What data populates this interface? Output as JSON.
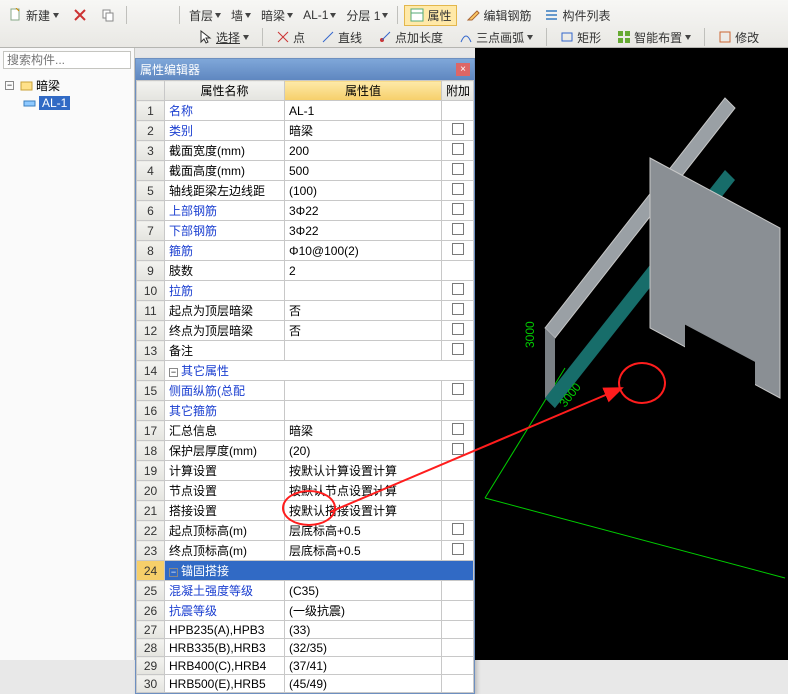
{
  "toolbar": {
    "new_label": "新建",
    "level_label": "首层",
    "wall_label": "墙",
    "hidden_beam_label": "暗梁",
    "component_label": "AL-1",
    "layer_label": "分层 1",
    "attr_btn": "属性",
    "edit_rebar_btn": "编辑钢筋",
    "component_list_btn": "构件列表",
    "select_btn": "选择",
    "point_btn": "点",
    "line_btn": "直线",
    "pt_lengthen_btn": "点加长度",
    "arc3_btn": "三点画弧",
    "rect_btn": "矩形",
    "smart_layout_btn": "智能布置",
    "modify_btn": "修改"
  },
  "left": {
    "search_placeholder": "搜索构件...",
    "tree_root": "暗梁",
    "tree_item": "AL-1"
  },
  "propwin": {
    "title": "属性编辑器",
    "col_name": "属性名称",
    "col_val": "属性值",
    "col_ext": "附加"
  },
  "rows": [
    {
      "n": "1",
      "name": "名称",
      "val": "AL-1",
      "link": true,
      "chk": false
    },
    {
      "n": "2",
      "name": "类别",
      "val": "暗梁",
      "link": true,
      "chk": true
    },
    {
      "n": "3",
      "name": "截面宽度(mm)",
      "val": "200",
      "chk": true
    },
    {
      "n": "4",
      "name": "截面高度(mm)",
      "val": "500",
      "chk": true
    },
    {
      "n": "5",
      "name": "轴线距梁左边线距",
      "val": "(100)",
      "chk": true
    },
    {
      "n": "6",
      "name": "上部钢筋",
      "val": "3Φ22",
      "link": true,
      "chk": true
    },
    {
      "n": "7",
      "name": "下部钢筋",
      "val": "3Φ22",
      "link": true,
      "chk": true
    },
    {
      "n": "8",
      "name": "箍筋",
      "val": "Φ10@100(2)",
      "link": true,
      "chk": true
    },
    {
      "n": "9",
      "name": "肢数",
      "val": "2",
      "chk": false
    },
    {
      "n": "10",
      "name": "拉筋",
      "val": "",
      "link": true,
      "chk": true
    },
    {
      "n": "11",
      "name": "起点为顶层暗梁",
      "val": "否",
      "chk": true
    },
    {
      "n": "12",
      "name": "终点为顶层暗梁",
      "val": "否",
      "chk": true
    },
    {
      "n": "13",
      "name": "备注",
      "val": "",
      "chk": true
    },
    {
      "n": "14",
      "name": "其它属性",
      "section": true,
      "link": true
    },
    {
      "n": "15",
      "name": "侧面纵筋(总配",
      "val": "",
      "indent": true,
      "link": true,
      "chk": true
    },
    {
      "n": "16",
      "name": "其它箍筋",
      "val": "",
      "indent": true,
      "link": true,
      "chk": false
    },
    {
      "n": "17",
      "name": "汇总信息",
      "val": "暗梁",
      "indent": true,
      "chk": true
    },
    {
      "n": "18",
      "name": "保护层厚度(mm)",
      "val": "(20)",
      "indent": true,
      "chk": true
    },
    {
      "n": "19",
      "name": "计算设置",
      "val": "按默认计算设置计算",
      "indent": true,
      "chk": false
    },
    {
      "n": "20",
      "name": "节点设置",
      "val": "按默认节点设置计算",
      "indent": true,
      "chk": false
    },
    {
      "n": "21",
      "name": "搭接设置",
      "val": "按默认搭接设置计算",
      "indent": true,
      "chk": false
    },
    {
      "n": "22",
      "name": "起点顶标高(m)",
      "val": "层底标高+0.5",
      "indent": true,
      "chk": true
    },
    {
      "n": "23",
      "name": "终点顶标高(m)",
      "val": "层底标高+0.5",
      "indent": true,
      "chk": true
    },
    {
      "n": "24",
      "name": "锚固搭接",
      "section": true,
      "link": true,
      "sel": true
    },
    {
      "n": "25",
      "name": "混凝土强度等级",
      "val": "(C35)",
      "indent": true,
      "link": true,
      "chk": false
    },
    {
      "n": "26",
      "name": "抗震等级",
      "val": "(一级抗震)",
      "indent": true,
      "link": true,
      "chk": false
    },
    {
      "n": "27",
      "name": "HPB235(A),HPB3",
      "val": "(33)",
      "indent": true,
      "chk": false
    },
    {
      "n": "28",
      "name": "HRB335(B),HRB3",
      "val": "(32/35)",
      "indent": true,
      "chk": false
    },
    {
      "n": "29",
      "name": "HRB400(C),HRB4",
      "val": "(37/41)",
      "indent": true,
      "chk": false
    },
    {
      "n": "30",
      "name": "HRB500(E),HRB5",
      "val": "(45/49)",
      "indent": true,
      "chk": false
    }
  ],
  "viewport": {
    "dim1": "3000",
    "dim2": "3000"
  }
}
